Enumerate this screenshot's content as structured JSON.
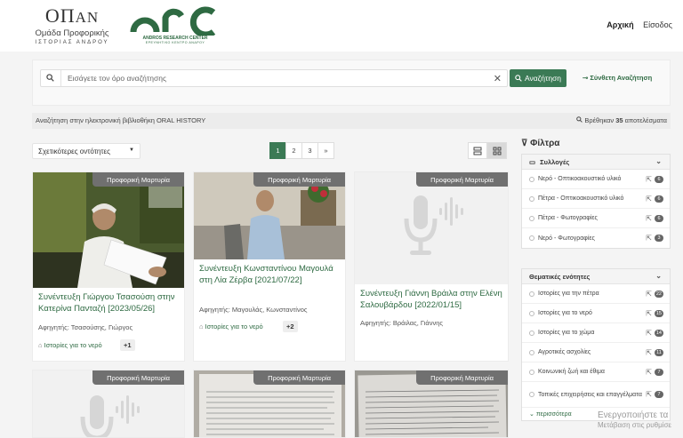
{
  "header": {
    "logo_oipan": {
      "main": "ΟΠ",
      "tail": "ΑΝ",
      "subtitle": "Ομάδα Προφορικής",
      "tagline": "ΙΣΤΟΡΙΑΣ ΑΝΔΡΟΥ"
    },
    "logo_arc": {
      "name": "ANDROS RESEARCH CENTER",
      "subname": "ΕΡΕΥΝΗΤΙΚΟ ΚΕΝΤΡΟ ΑΝΔΡΟΥ"
    },
    "nav": {
      "home": "Αρχική",
      "login": "Είσοδος"
    }
  },
  "search": {
    "placeholder": "Εισάγετε τον όρο αναζήτησης",
    "button": "Αναζήτηση",
    "advanced": "Σύνθετη Αναζήτηση"
  },
  "info": {
    "left": "Αναζήτηση στην ηλεκτρονική βιβλιοθήκη ORAL HISTORY",
    "found_prefix": "Βρέθηκαν",
    "found_count": "35",
    "found_suffix": "αποτελέσματα"
  },
  "sort": {
    "selected": "Σχετικότερες οντότητες"
  },
  "pagination": {
    "pages": [
      "1",
      "2",
      "3"
    ],
    "next": "»",
    "current": "1"
  },
  "cards": [
    {
      "badge": "Προφορική Μαρτυρία",
      "title": "Συνέντευξη Γιώργου Τσασούση στην Κατερίνα Πανταζή [2023/05/26]",
      "meta": "Αφηγητής: Τσασούσης, Γιώργος",
      "tag": "Ιστορίες για το νερό",
      "more": "+1"
    },
    {
      "badge": "Προφορική Μαρτυρία",
      "title": "Συνέντευξη Κωνσταντίνου Μαγουλά στη Λία Ζέρβα [2021/07/22]",
      "meta": "Αφηγητής: Μαγουλάς, Κωνσταντίνος",
      "tag": "Ιστορίες για το νερό",
      "more": "+2"
    },
    {
      "badge": "Προφορική Μαρτυρία",
      "title": "Συνέντευξη Γιάννη Βράιλα στην Ελένη Σαλουβάρδου [2022/01/15]",
      "meta": "Αφηγητής: Βράιλας, Γιάννης"
    },
    {
      "badge": "Προφορική Μαρτυρία"
    },
    {
      "badge": "Προφορική Μαρτυρία"
    },
    {
      "badge": "Προφορική Μαρτυρία"
    }
  ],
  "filters": {
    "title": "Φίλτρα",
    "groups": [
      {
        "title": "Συλλογές",
        "items": [
          {
            "label": "Νερό - Οπτικοακουστικό υλικό",
            "count": "6"
          },
          {
            "label": "Πέτρα - Οπτικοακουστικό υλικό",
            "count": "6"
          },
          {
            "label": "Πέτρα - Φωτογραφίες",
            "count": "6"
          },
          {
            "label": "Νερό - Φωτογραφίες",
            "count": "3"
          }
        ]
      },
      {
        "title": "Θεματικές ενότητες",
        "items": [
          {
            "label": "Ιστορίες για την πέτρα",
            "count": "22"
          },
          {
            "label": "Ιστορίες για το νερό",
            "count": "15"
          },
          {
            "label": "Ιστορίες για το χώμα",
            "count": "14"
          },
          {
            "label": "Αγροτικές ασχολίες",
            "count": "11"
          },
          {
            "label": "Κοινωνική ζωή και έθιμα",
            "count": "7"
          },
          {
            "label": "Τοπικές επιχειρήσεις και επαγγέλματα",
            "count": "7"
          }
        ],
        "more": "περισσότερα"
      }
    ]
  },
  "watermark": {
    "line1": "Ενεργοποιήστε τα",
    "line2": "Μετάβαση στις ρυθμίσε"
  },
  "colors": {
    "accent": "#3b7a55",
    "accent_text": "#2e6a42",
    "badge": "#707070"
  },
  "icons": [
    "search-icon",
    "clear-icon",
    "filter-icon",
    "folder-icon",
    "chevron-down-icon",
    "external-link-icon",
    "tag-icon",
    "list-view-icon",
    "grid-view-icon",
    "microphone-icon"
  ]
}
